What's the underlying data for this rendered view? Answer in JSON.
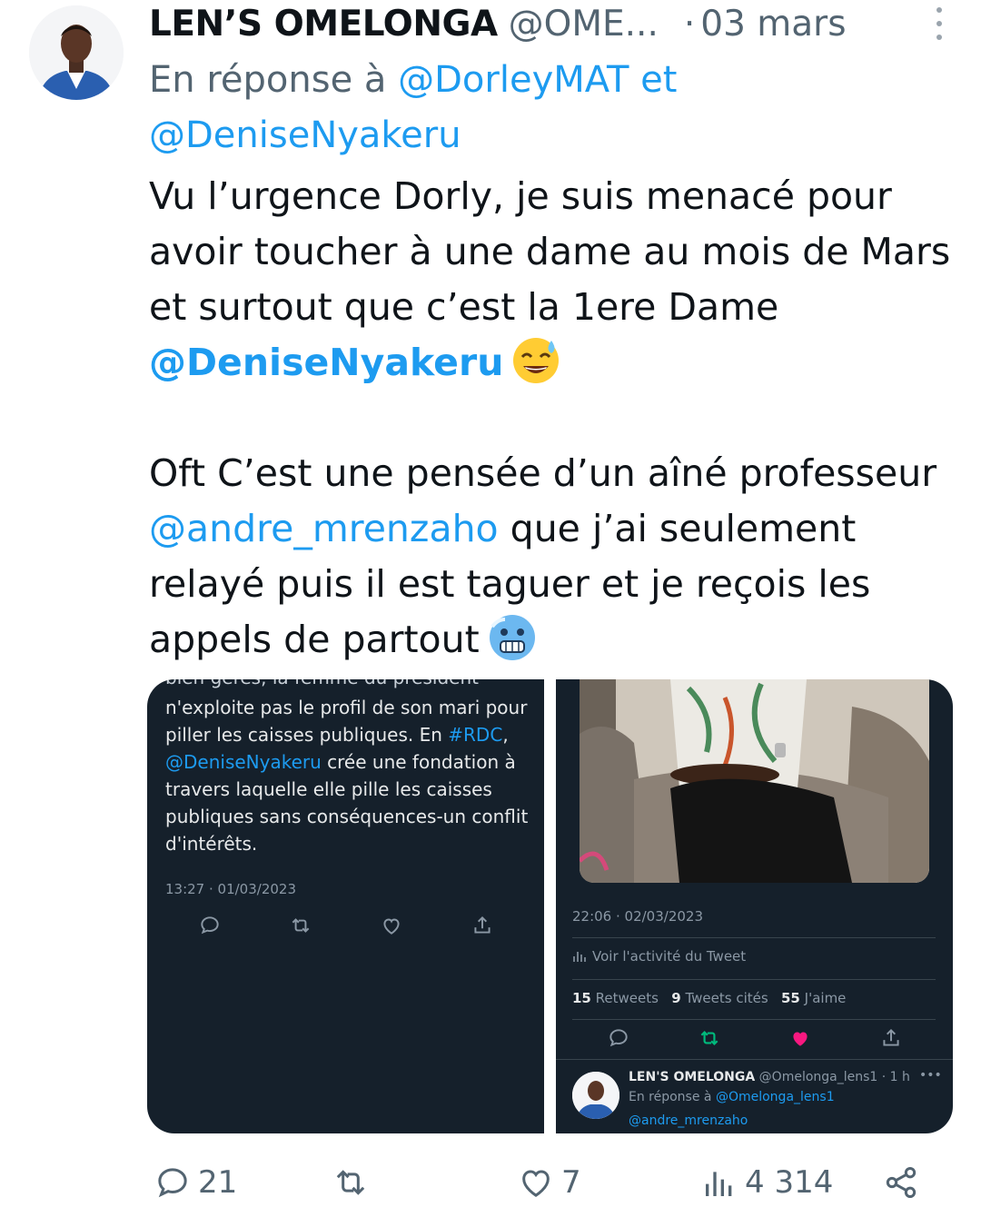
{
  "tweet": {
    "author_name": "LEN’S OMELONGA",
    "author_handle": "@OME...",
    "separator": "·",
    "date": "03 mars",
    "reply_prefix": "En réponse à",
    "reply_mention_1": "@DorleyMAT",
    "reply_conjunction": "et",
    "reply_mention_2": "@DeniseNyakeru",
    "text_line_1": "Vu l’urgence Dorly, je suis menacé pour",
    "text_line_2": "avoir toucher à une dame au mois de Mars",
    "text_line_3": "et surtout que c’est la 1ere Dame",
    "text_mention_bold": "@DeniseNyakeru",
    "text_line_5": "Oft C’est une pensée d’un aîné professeur",
    "text_mention_2": "@andre_mrenzaho",
    "text_line_6_rest": " que j’ai seulement",
    "text_line_7": "relayé puis il est taguer et je reçois les",
    "text_line_8": "appels de partout",
    "emoji_1": "sweat-smile-emoji",
    "emoji_2": "cold-face-emoji"
  },
  "media_left": {
    "cut_line": "bien gérés, la femme du président",
    "line_1": "n'exploite pas le profil de son mari pour",
    "line_2_a": "piller les caisses publiques.  En ",
    "hashtag": "#RDC",
    "line_2_b": ",",
    "mention": "@DeniseNyakeru",
    "line_3_rest": " crée une fondation à",
    "line_4": "travers laquelle elle pille les caisses",
    "line_5": "publiques sans conséquences-un conflit",
    "line_6": "d'intérêts.",
    "timestamp": "13:27 · 01/03/2023"
  },
  "media_right": {
    "timestamp": "22:06 · 02/03/2023",
    "activity_label": "Voir l'activité du Tweet",
    "retweets_count": "15",
    "retweets_label": "Retweets",
    "quotes_count": "9",
    "quotes_label": "Tweets cités",
    "likes_count": "55",
    "likes_label": "J'aime",
    "reply_author_name": "LEN'S OMELONGA",
    "reply_author_handle": "@Omelonga_lens1 · 1 h",
    "reply_more": "•••",
    "reply_prefix": "En réponse à",
    "reply_mention": "@Omelonga_lens1",
    "reply_text_mention": "@andre_mrenzaho"
  },
  "actions": {
    "replies": "21",
    "retweets": "",
    "likes": "7",
    "views": "4 314"
  },
  "colors": {
    "accent": "#1d9bf0",
    "secondary_text": "#536471",
    "dark_panel": "#15202b",
    "like_active": "#f91880",
    "retweet_active": "#00ba7c"
  }
}
